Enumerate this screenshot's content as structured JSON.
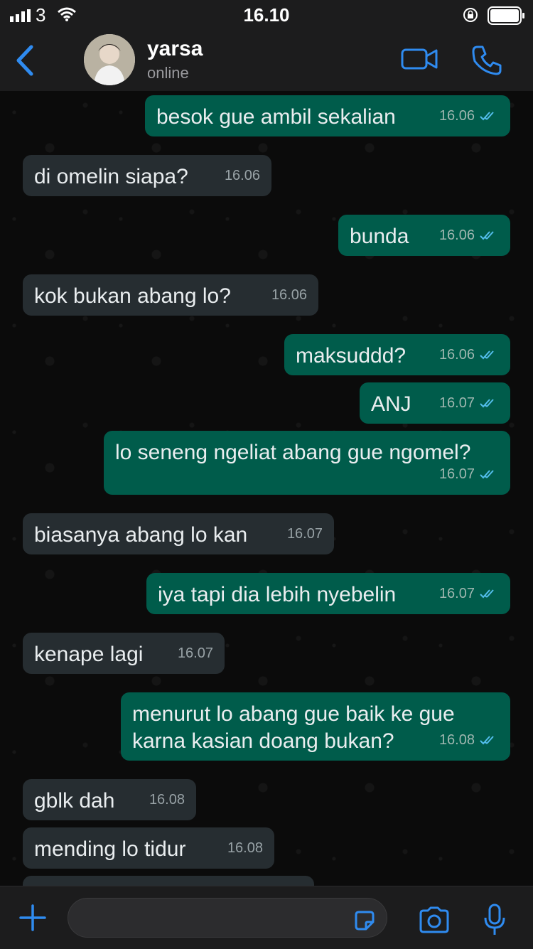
{
  "statusbar": {
    "carrier": "3",
    "time": "16.10"
  },
  "header": {
    "name": "yarsa",
    "status": "online"
  },
  "messages": [
    {
      "dir": "out",
      "text": "besok gue ambil sekalian",
      "time": "16.06"
    },
    {
      "dir": "in",
      "text": "di omelin siapa?",
      "time": "16.06"
    },
    {
      "dir": "out",
      "text": "bunda",
      "time": "16.06"
    },
    {
      "dir": "in",
      "text": "kok bukan abang lo?",
      "time": "16.06"
    },
    {
      "dir": "out",
      "text": "maksuddd?",
      "time": "16.06"
    },
    {
      "dir": "out",
      "text": "ANJ",
      "time": "16.07"
    },
    {
      "dir": "out",
      "text": "lo seneng ngeliat abang gue ngomel?",
      "time": "16.07"
    },
    {
      "dir": "in",
      "text": "biasanya abang lo kan",
      "time": "16.07"
    },
    {
      "dir": "out",
      "text": "iya tapi dia lebih nyebelin",
      "time": "16.07"
    },
    {
      "dir": "in",
      "text": "kenape lagi",
      "time": "16.07"
    },
    {
      "dir": "out",
      "text": "menurut lo abang gue baik ke gue\nkarna kasian doang bukan?",
      "time": "16.08"
    },
    {
      "dir": "in",
      "text": "gblk dah",
      "time": "16.08"
    },
    {
      "dir": "in",
      "text": "mending lo tidur",
      "time": "16.08"
    }
  ],
  "composer": {
    "placeholder": ""
  },
  "colors": {
    "accent": "#2f8bf0",
    "outgoing_bubble": "#005c4b",
    "incoming_bubble": "#262d31",
    "read_tick": "#53bdeb"
  }
}
